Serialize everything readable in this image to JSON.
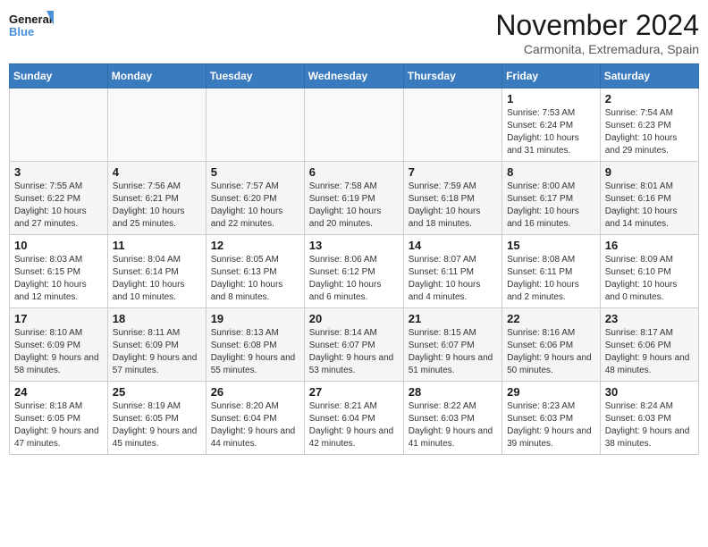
{
  "header": {
    "logo_general": "General",
    "logo_blue": "Blue",
    "month_title": "November 2024",
    "location": "Carmonita, Extremadura, Spain"
  },
  "weekdays": [
    "Sunday",
    "Monday",
    "Tuesday",
    "Wednesday",
    "Thursday",
    "Friday",
    "Saturday"
  ],
  "weeks": [
    [
      {
        "day": "",
        "info": ""
      },
      {
        "day": "",
        "info": ""
      },
      {
        "day": "",
        "info": ""
      },
      {
        "day": "",
        "info": ""
      },
      {
        "day": "",
        "info": ""
      },
      {
        "day": "1",
        "info": "Sunrise: 7:53 AM\nSunset: 6:24 PM\nDaylight: 10 hours and 31 minutes."
      },
      {
        "day": "2",
        "info": "Sunrise: 7:54 AM\nSunset: 6:23 PM\nDaylight: 10 hours and 29 minutes."
      }
    ],
    [
      {
        "day": "3",
        "info": "Sunrise: 7:55 AM\nSunset: 6:22 PM\nDaylight: 10 hours and 27 minutes."
      },
      {
        "day": "4",
        "info": "Sunrise: 7:56 AM\nSunset: 6:21 PM\nDaylight: 10 hours and 25 minutes."
      },
      {
        "day": "5",
        "info": "Sunrise: 7:57 AM\nSunset: 6:20 PM\nDaylight: 10 hours and 22 minutes."
      },
      {
        "day": "6",
        "info": "Sunrise: 7:58 AM\nSunset: 6:19 PM\nDaylight: 10 hours and 20 minutes."
      },
      {
        "day": "7",
        "info": "Sunrise: 7:59 AM\nSunset: 6:18 PM\nDaylight: 10 hours and 18 minutes."
      },
      {
        "day": "8",
        "info": "Sunrise: 8:00 AM\nSunset: 6:17 PM\nDaylight: 10 hours and 16 minutes."
      },
      {
        "day": "9",
        "info": "Sunrise: 8:01 AM\nSunset: 6:16 PM\nDaylight: 10 hours and 14 minutes."
      }
    ],
    [
      {
        "day": "10",
        "info": "Sunrise: 8:03 AM\nSunset: 6:15 PM\nDaylight: 10 hours and 12 minutes."
      },
      {
        "day": "11",
        "info": "Sunrise: 8:04 AM\nSunset: 6:14 PM\nDaylight: 10 hours and 10 minutes."
      },
      {
        "day": "12",
        "info": "Sunrise: 8:05 AM\nSunset: 6:13 PM\nDaylight: 10 hours and 8 minutes."
      },
      {
        "day": "13",
        "info": "Sunrise: 8:06 AM\nSunset: 6:12 PM\nDaylight: 10 hours and 6 minutes."
      },
      {
        "day": "14",
        "info": "Sunrise: 8:07 AM\nSunset: 6:11 PM\nDaylight: 10 hours and 4 minutes."
      },
      {
        "day": "15",
        "info": "Sunrise: 8:08 AM\nSunset: 6:11 PM\nDaylight: 10 hours and 2 minutes."
      },
      {
        "day": "16",
        "info": "Sunrise: 8:09 AM\nSunset: 6:10 PM\nDaylight: 10 hours and 0 minutes."
      }
    ],
    [
      {
        "day": "17",
        "info": "Sunrise: 8:10 AM\nSunset: 6:09 PM\nDaylight: 9 hours and 58 minutes."
      },
      {
        "day": "18",
        "info": "Sunrise: 8:11 AM\nSunset: 6:09 PM\nDaylight: 9 hours and 57 minutes."
      },
      {
        "day": "19",
        "info": "Sunrise: 8:13 AM\nSunset: 6:08 PM\nDaylight: 9 hours and 55 minutes."
      },
      {
        "day": "20",
        "info": "Sunrise: 8:14 AM\nSunset: 6:07 PM\nDaylight: 9 hours and 53 minutes."
      },
      {
        "day": "21",
        "info": "Sunrise: 8:15 AM\nSunset: 6:07 PM\nDaylight: 9 hours and 51 minutes."
      },
      {
        "day": "22",
        "info": "Sunrise: 8:16 AM\nSunset: 6:06 PM\nDaylight: 9 hours and 50 minutes."
      },
      {
        "day": "23",
        "info": "Sunrise: 8:17 AM\nSunset: 6:06 PM\nDaylight: 9 hours and 48 minutes."
      }
    ],
    [
      {
        "day": "24",
        "info": "Sunrise: 8:18 AM\nSunset: 6:05 PM\nDaylight: 9 hours and 47 minutes."
      },
      {
        "day": "25",
        "info": "Sunrise: 8:19 AM\nSunset: 6:05 PM\nDaylight: 9 hours and 45 minutes."
      },
      {
        "day": "26",
        "info": "Sunrise: 8:20 AM\nSunset: 6:04 PM\nDaylight: 9 hours and 44 minutes."
      },
      {
        "day": "27",
        "info": "Sunrise: 8:21 AM\nSunset: 6:04 PM\nDaylight: 9 hours and 42 minutes."
      },
      {
        "day": "28",
        "info": "Sunrise: 8:22 AM\nSunset: 6:03 PM\nDaylight: 9 hours and 41 minutes."
      },
      {
        "day": "29",
        "info": "Sunrise: 8:23 AM\nSunset: 6:03 PM\nDaylight: 9 hours and 39 minutes."
      },
      {
        "day": "30",
        "info": "Sunrise: 8:24 AM\nSunset: 6:03 PM\nDaylight: 9 hours and 38 minutes."
      }
    ]
  ]
}
